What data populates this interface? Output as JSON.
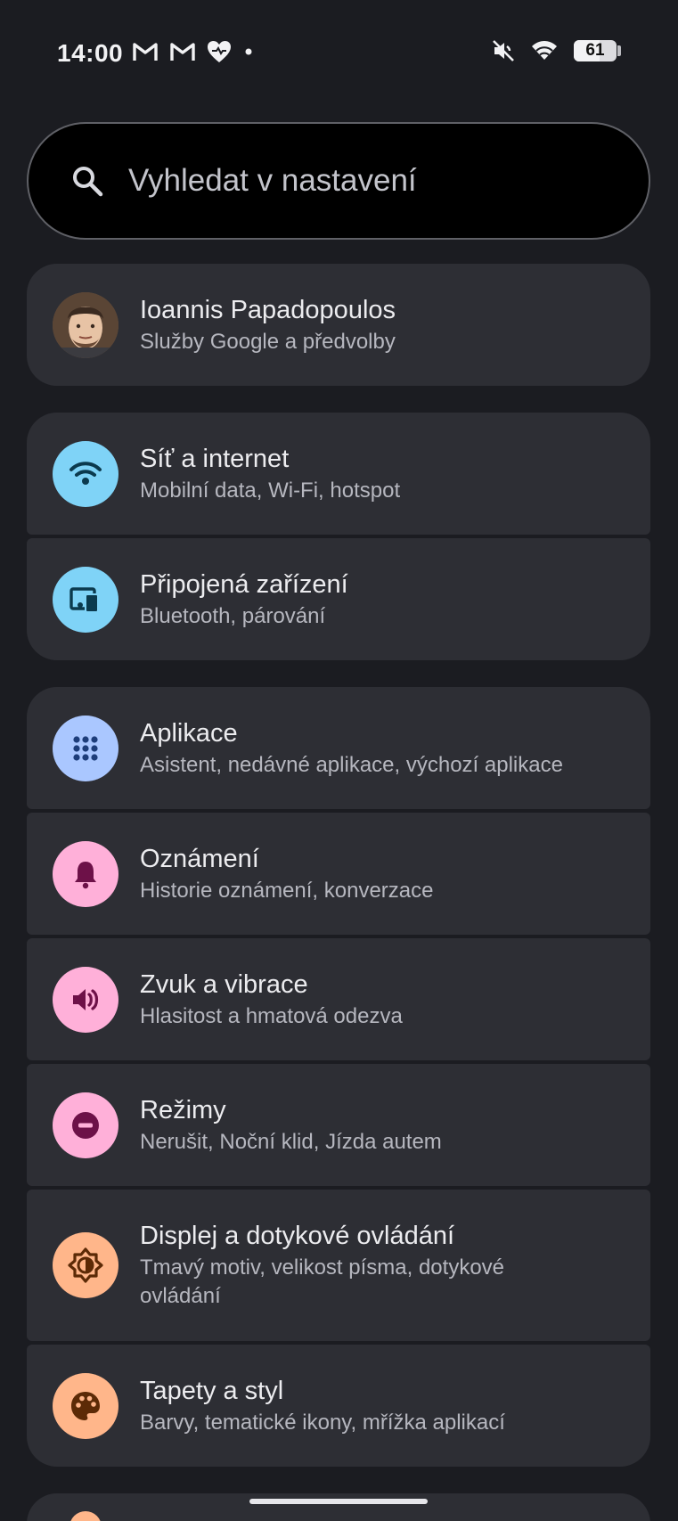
{
  "status_bar": {
    "time": "14:00",
    "left_icons": [
      "gmail-icon",
      "gmail-icon",
      "health-heart-icon",
      "dot-icon"
    ],
    "right_icons": [
      "mute-icon",
      "wifi-icon",
      "battery-icon"
    ],
    "battery_level": "61"
  },
  "search": {
    "placeholder": "Vyhledat v nastavení"
  },
  "account": {
    "name": "Ioannis Papadopoulos",
    "subtitle": "Služby Google a předvolby"
  },
  "group1": [
    {
      "title": "Síť a internet",
      "subtitle": "Mobilní data, Wi-Fi, hotspot",
      "icon": "wifi-icon",
      "color": "#7fd3f7"
    },
    {
      "title": "Připojená zařízení",
      "subtitle": "Bluetooth, párování",
      "icon": "connected-devices-icon",
      "color": "#7fd3f7"
    }
  ],
  "group2": [
    {
      "title": "Aplikace",
      "subtitle": "Asistent, nedávné aplikace, výchozí aplikace",
      "icon": "apps-grid-icon",
      "color": "#aac7ff"
    },
    {
      "title": "Oznámení",
      "subtitle": "Historie oznámení, konverzace",
      "icon": "bell-icon",
      "color": "#ffb0d9"
    },
    {
      "title": "Zvuk a vibrace",
      "subtitle": "Hlasitost a hmatová odezva",
      "icon": "volume-icon",
      "color": "#ffb0d9"
    },
    {
      "title": "Režimy",
      "subtitle": "Nerušit, Noční klid, Jízda autem",
      "icon": "do-not-disturb-icon",
      "color": "#ffb0d9"
    },
    {
      "title": "Displej a dotykové ovládání",
      "subtitle": "Tmavý motiv, velikost písma, dotykové ovládání",
      "icon": "brightness-icon",
      "color": "#ffb68a"
    },
    {
      "title": "Tapety a styl",
      "subtitle": "Barvy, tematické ikony, mřížka aplikací",
      "icon": "palette-icon",
      "color": "#ffb68a"
    }
  ]
}
